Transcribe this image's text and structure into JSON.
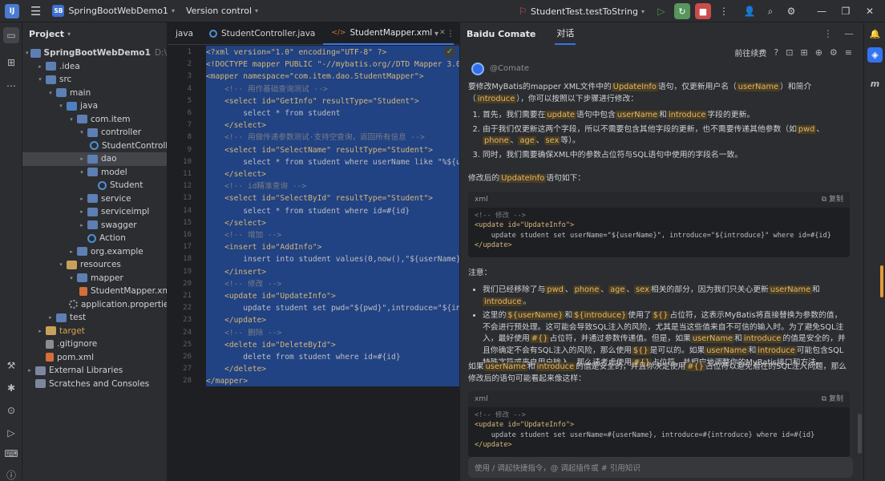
{
  "titlebar": {
    "project_badge": "SB",
    "project_name": "SpringBootWebDemo1",
    "vcs": "Version control",
    "run_config": "StudentTest.testToString"
  },
  "project_panel": {
    "title": "Project",
    "tree": [
      {
        "label": "SpringBootWebDemo1",
        "hint": "D:\\save\\st",
        "depth": 0,
        "tw": "▾",
        "icon": "folder",
        "bold": true
      },
      {
        "label": ".idea",
        "depth": 1,
        "tw": "▸",
        "icon": "folder"
      },
      {
        "label": "src",
        "depth": 1,
        "tw": "▾",
        "icon": "folder"
      },
      {
        "label": "main",
        "depth": 2,
        "tw": "▾",
        "icon": "folder"
      },
      {
        "label": "java",
        "depth": 3,
        "tw": "▾",
        "icon": "src"
      },
      {
        "label": "com.item",
        "depth": 4,
        "tw": "▾",
        "icon": "folder"
      },
      {
        "label": "controller",
        "depth": 5,
        "tw": "▾",
        "icon": "folder"
      },
      {
        "label": "StudentController",
        "depth": 6,
        "tw": "",
        "icon": "class"
      },
      {
        "label": "dao",
        "depth": 5,
        "tw": "▸",
        "icon": "folder",
        "selected": true
      },
      {
        "label": "model",
        "depth": 5,
        "tw": "▾",
        "icon": "folder"
      },
      {
        "label": "Student",
        "depth": 6,
        "tw": "",
        "icon": "class"
      },
      {
        "label": "service",
        "depth": 5,
        "tw": "▸",
        "icon": "folder"
      },
      {
        "label": "serviceimpl",
        "depth": 5,
        "tw": "▸",
        "icon": "folder"
      },
      {
        "label": "swagger",
        "depth": 5,
        "tw": "▸",
        "icon": "folder"
      },
      {
        "label": "Action",
        "depth": 5,
        "tw": "",
        "icon": "class"
      },
      {
        "label": "org.example",
        "depth": 4,
        "tw": "▸",
        "icon": "folder"
      },
      {
        "label": "resources",
        "depth": 3,
        "tw": "▾",
        "icon": "res"
      },
      {
        "label": "mapper",
        "depth": 4,
        "tw": "▾",
        "icon": "folder"
      },
      {
        "label": "StudentMapper.xml",
        "depth": 5,
        "tw": "",
        "icon": "xml"
      },
      {
        "label": "application.properties",
        "depth": 4,
        "tw": "",
        "icon": "gear"
      },
      {
        "label": "test",
        "depth": 2,
        "tw": "▸",
        "icon": "folder"
      },
      {
        "label": "target",
        "depth": 1,
        "tw": "▸",
        "icon": "res",
        "orange": true
      },
      {
        "label": ".gitignore",
        "depth": 1,
        "tw": "",
        "icon": "file"
      },
      {
        "label": "pom.xml",
        "depth": 1,
        "tw": "",
        "icon": "xml"
      },
      {
        "label": "External Libraries",
        "depth": 0,
        "tw": "▸",
        "icon": "lib"
      },
      {
        "label": "Scratches and Consoles",
        "depth": 0,
        "tw": "",
        "icon": "lib"
      }
    ]
  },
  "editor": {
    "tabs": [
      {
        "label": "java",
        "kind": "partial"
      },
      {
        "label": "StudentController.java",
        "kind": "java"
      },
      {
        "label": "StudentMapper.xml",
        "kind": "xml",
        "active": true
      }
    ],
    "lines": [
      {
        "n": "1",
        "t": "<?xml version=\"1.0\" encoding=\"UTF-8\" ?>",
        "c": "tg"
      },
      {
        "n": "2",
        "t": "<!DOCTYPE mapper PUBLIC \"-//mybatis.org//DTD Mapper 3.0//",
        "c": "tg"
      },
      {
        "n": "3",
        "t": "<mapper namespace=\"com.item.dao.StudentMapper\">",
        "c": "tg"
      },
      {
        "n": "4",
        "t": "    <!-- 用作基础查询测试 -->",
        "c": "cm"
      },
      {
        "n": "5",
        "t": "    <select id=\"GetInfo\" resultType=\"Student\">",
        "c": "tg"
      },
      {
        "n": "6",
        "t": "        select * from student",
        "c": "tx"
      },
      {
        "n": "7",
        "t": "    </select>",
        "c": "tg"
      },
      {
        "n": "8",
        "t": "    <!-- 用做传递参数测试·支持空查询，返回所有信息 -->",
        "c": "cm"
      },
      {
        "n": "9",
        "t": "    <select id=\"SelectName\" resultType=\"Student\">",
        "c": "tg"
      },
      {
        "n": "10",
        "t": "        select * from student where userName like \"%${use",
        "c": "tx"
      },
      {
        "n": "11",
        "t": "    </select>",
        "c": "tg"
      },
      {
        "n": "12",
        "t": "    <!-- id精准查询 -->",
        "c": "cm"
      },
      {
        "n": "13",
        "t": "    <select id=\"SelectById\" resultType=\"Student\">",
        "c": "tg"
      },
      {
        "n": "14",
        "t": "        select * from student where id=#{id}",
        "c": "tx"
      },
      {
        "n": "15",
        "t": "    </select>",
        "c": "tg"
      },
      {
        "n": "16",
        "t": "    <!-- 增加 -->",
        "c": "cm"
      },
      {
        "n": "17",
        "t": "    <insert id=\"AddInfo\">",
        "c": "tg"
      },
      {
        "n": "18",
        "t": "        insert into student values(0,now(),\"${userName}\",",
        "c": "tx"
      },
      {
        "n": "19",
        "t": "    </insert>",
        "c": "tg"
      },
      {
        "n": "20",
        "t": "    <!-- 修改 -->",
        "c": "cm"
      },
      {
        "n": "21",
        "t": "    <update id=\"UpdateInfo\">",
        "c": "tg"
      },
      {
        "n": "22",
        "t": "        update student set pwd=\"${pwd}\",introduce=\"${intr",
        "c": "tx"
      },
      {
        "n": "23",
        "t": "    </update>",
        "c": "tg"
      },
      {
        "n": "24",
        "t": "    <!-- 删除 -->",
        "c": "cm"
      },
      {
        "n": "25",
        "t": "    <delete id=\"DeleteById\">",
        "c": "tg"
      },
      {
        "n": "26",
        "t": "        delete from student where id=#{id}",
        "c": "tx"
      },
      {
        "n": "27",
        "t": "    </delete>",
        "c": "tg"
      },
      {
        "n": "28",
        "t": "</mapper>",
        "c": "tg"
      }
    ]
  },
  "comate": {
    "title": "Baidu Comate",
    "tab": "对话",
    "top_action": "前往续费",
    "bot_name": "@Comate",
    "intro": [
      {
        "t": "要修改MyBatis的mapper XML文件中的"
      },
      {
        "t": "UpdateInfo",
        "h": true
      },
      {
        "t": "语句，仅更新用户名（"
      },
      {
        "t": "userName",
        "h": true
      },
      {
        "t": "）和简介（"
      },
      {
        "t": "introduce",
        "h": true
      },
      {
        "t": "），你可以按照以下步骤进行修改："
      }
    ],
    "steps": [
      [
        {
          "t": "首先，我们需要在"
        },
        {
          "t": "update",
          "h": true
        },
        {
          "t": "语句中包含"
        },
        {
          "t": "userName",
          "h": true
        },
        {
          "t": "和"
        },
        {
          "t": "introduce",
          "h": true
        },
        {
          "t": "字段的更新。"
        }
      ],
      [
        {
          "t": "由于我们仅更新这两个字段，所以不需要包含其他字段的更新，也不需要传递其他参数（如"
        },
        {
          "t": "pwd",
          "h": true
        },
        {
          "t": "、"
        },
        {
          "t": "phone",
          "h": true
        },
        {
          "t": "、"
        },
        {
          "t": "age",
          "h": true
        },
        {
          "t": "、"
        },
        {
          "t": "sex",
          "h": true
        },
        {
          "t": "等）。"
        }
      ],
      [
        {
          "t": "同时，我们需要确保XML中的参数占位符与SQL语句中使用的字段名一致。"
        }
      ]
    ],
    "after_steps": [
      {
        "t": "修改后的"
      },
      {
        "t": "UpdateInfo",
        "h": true
      },
      {
        "t": "语句如下："
      }
    ],
    "code1": {
      "lang": "xml",
      "copy": "复制",
      "lines": [
        {
          "t": "<!-- 修改 -->",
          "c": "cm"
        },
        {
          "t": "<update id=\"UpdateInfo\">",
          "c": "tg"
        },
        {
          "t": "    update student set userName=\"${userName}\", introduce=\"${introduce}\" where id=#{id}",
          "c": "tx"
        },
        {
          "t": "</update>",
          "c": "tg"
        }
      ]
    },
    "note_title": "注意：",
    "notes": [
      [
        {
          "t": "我们已经移除了与"
        },
        {
          "t": "pwd",
          "h": true
        },
        {
          "t": "、"
        },
        {
          "t": "phone",
          "h": true
        },
        {
          "t": "、"
        },
        {
          "t": "age",
          "h": true
        },
        {
          "t": "、"
        },
        {
          "t": "sex",
          "h": true
        },
        {
          "t": "相关的部分，因为我们只关心更新"
        },
        {
          "t": "userName",
          "h": true
        },
        {
          "t": "和"
        },
        {
          "t": "introduce",
          "h": true
        },
        {
          "t": "。"
        }
      ],
      [
        {
          "t": "这里的"
        },
        {
          "t": "${userName}",
          "h": true
        },
        {
          "t": "和"
        },
        {
          "t": "${introduce}",
          "h": true
        },
        {
          "t": "使用了"
        },
        {
          "t": "${}",
          "h": true
        },
        {
          "t": "占位符，这表示MyBatis将直接替换为参数的值，不会进行预处理。这可能会导致SQL注入的风险，尤其是当这些值来自不可信的输入时。为了避免SQL注入，最好使用"
        },
        {
          "t": "#{}",
          "h": true
        },
        {
          "t": "占位符，并通过参数传递值。但是，如果"
        },
        {
          "t": "userName",
          "h": true
        },
        {
          "t": "和"
        },
        {
          "t": "introduce",
          "h": true
        },
        {
          "t": "的值是安全的，并且你确定不会有SQL注入的风险，那么使用"
        },
        {
          "t": "${}",
          "h": true
        },
        {
          "t": "是可以的。如果"
        },
        {
          "t": "userName",
          "h": true
        },
        {
          "t": "和"
        },
        {
          "t": "introduce",
          "h": true
        },
        {
          "t": "可能包含SQL特殊字符或来自用户输入，那么请考虑使用"
        },
        {
          "t": "#{}",
          "h": true
        },
        {
          "t": "占位符，并相应地调整你的MyBatis接口和方法。"
        }
      ]
    ],
    "closing": [
      {
        "t": "如果"
      },
      {
        "t": "userName",
        "h": true
      },
      {
        "t": "和"
      },
      {
        "t": "introduce",
        "h": true
      },
      {
        "t": "的值是安全的，并且你决定使用"
      },
      {
        "t": "#{}",
        "h": true
      },
      {
        "t": "占位符以避免潜在的SQL注入问题，那么修改后的语句可能看起来像这样："
      }
    ],
    "code2": {
      "lang": "xml",
      "copy": "复制",
      "lines": [
        {
          "t": "<!-- 修改 -->",
          "c": "cm"
        },
        {
          "t": "<update id=\"UpdateInfo\">",
          "c": "tg"
        },
        {
          "t": "    update student set userName=#{userName}, introduce=#{introduce} where id=#{id}",
          "c": "tx"
        },
        {
          "t": "</update>",
          "c": "tg"
        }
      ]
    },
    "input_placeholder": "使用 / 调起快捷指令，@ 调起插件或 # 引用知识"
  }
}
